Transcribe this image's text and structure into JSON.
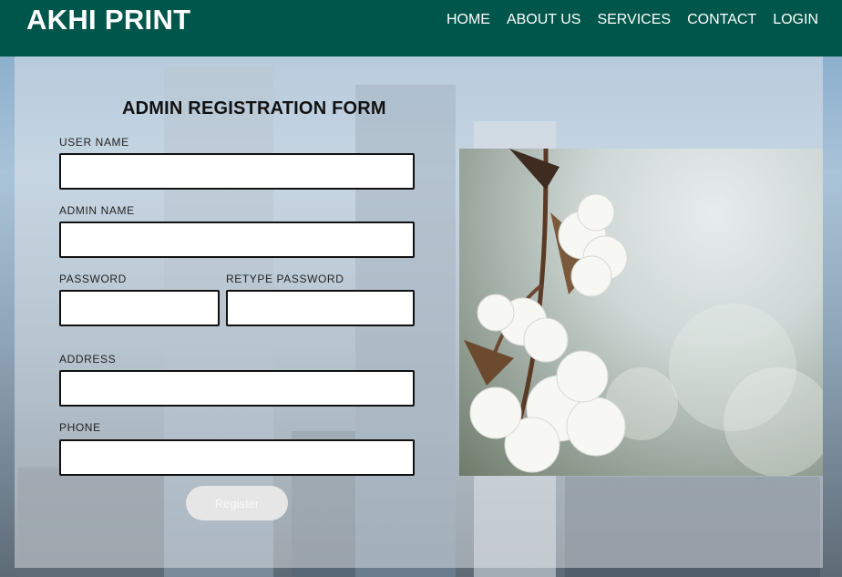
{
  "header": {
    "brand": "AKHI PRINT",
    "nav": [
      "HOME",
      "ABOUT US",
      "SERVICES",
      "CONTACT",
      "LOGIN"
    ]
  },
  "form": {
    "title": "ADMIN REGISTRATION FORM",
    "labels": {
      "user_name": "USER NAME",
      "admin_name": "ADMIN NAME",
      "password": "PASSWORD",
      "retype_password": "RETYPE PASSWORD",
      "address": "ADDRESS",
      "phone": "PHONE"
    },
    "values": {
      "user_name": "",
      "admin_name": "",
      "password": "",
      "retype_password": "",
      "address": "",
      "phone": ""
    },
    "submit_label": "Register"
  },
  "colors": {
    "header_bg": "#00564a",
    "text": "#111111"
  },
  "icons": {
    "photo": "cotton-plant-photo"
  }
}
